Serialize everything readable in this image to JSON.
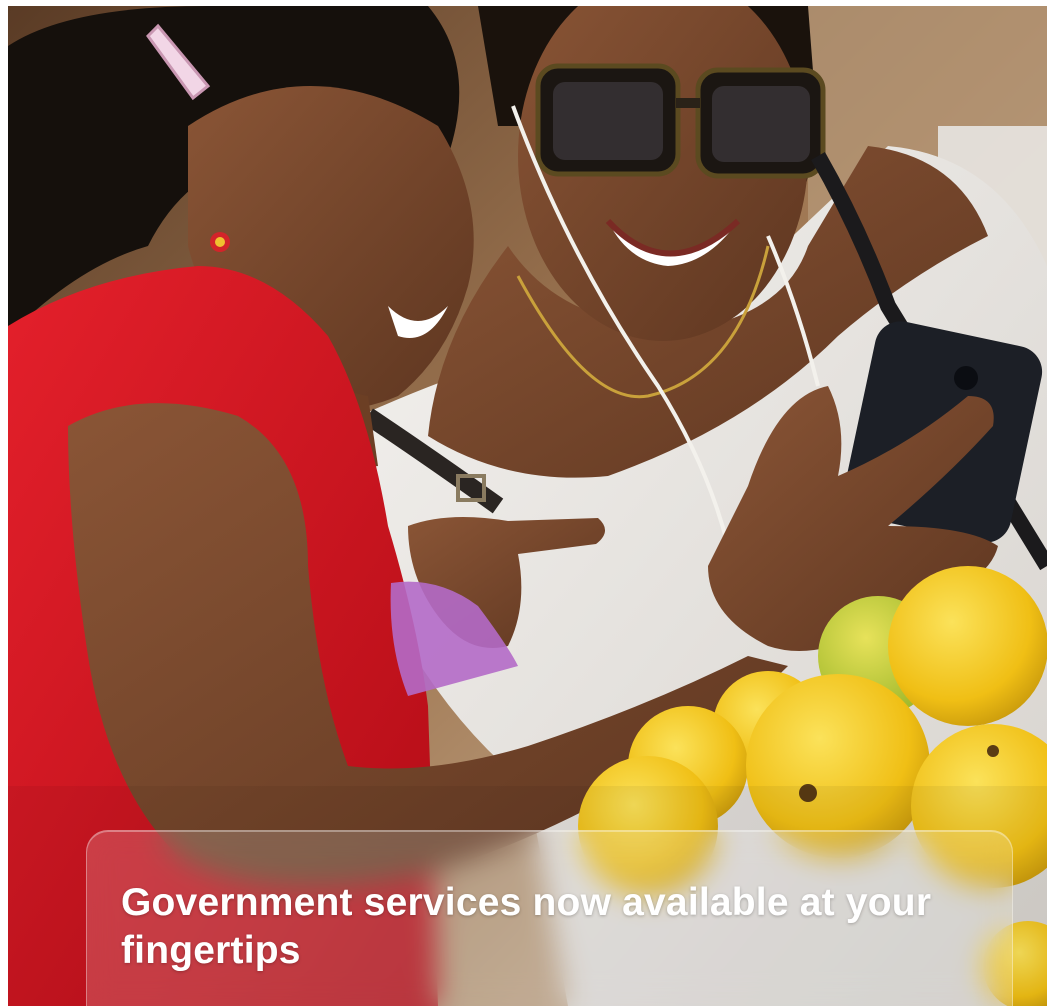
{
  "hero": {
    "image_label": "two-women-looking-at-phone-photo",
    "caption": "Government services now available at your fingertips"
  },
  "colors": {
    "red_shirt": "#d8141f",
    "white_top": "#ece9e6",
    "skin": "#7a4a2e",
    "fruit": "#f2c21c",
    "phone": "#1c1f26",
    "caption_text": "#ffffff"
  }
}
